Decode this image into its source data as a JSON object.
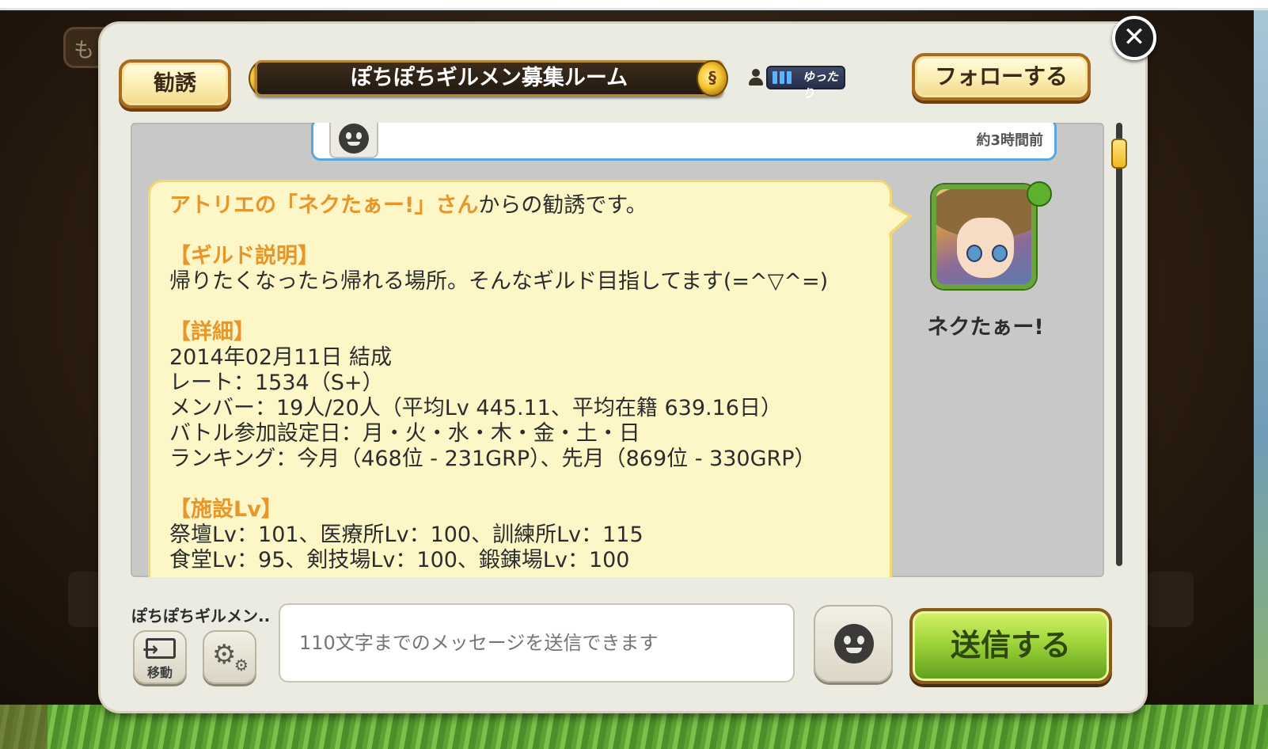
{
  "background": {
    "tab_label": "も"
  },
  "header": {
    "invite_button": "勧誘",
    "room_title": "ぽちぽちギルメン募集ルーム",
    "activity_badge": "ゆったり",
    "follow_button": "フォローする",
    "close_icon": "close-icon"
  },
  "chat": {
    "previous_message": {
      "avatar_icon": "smiley-face-icon",
      "timestamp": "約3時間前"
    },
    "invite_message": {
      "intro_highlight": "アトリエの「ネクたぁー!」さん",
      "intro_rest": "からの勧誘です。",
      "guild_desc_heading": "【ギルド説明】",
      "guild_desc": "帰りたくなったら帰れる場所。そんなギルド目指してます(=^▽^=)",
      "details_heading": "【詳細】",
      "founded": "2014年02月11日 結成",
      "rate": "レート：1534（S+）",
      "members": "メンバー：19人/20人（平均Lv 445.11、平均在籍 639.16日）",
      "battle_days": "バトル参加設定日：月・火・水・木・金・土・日",
      "ranking": "ランキング：今月（468位 - 231GRP）、先月（869位 - 330GRP）",
      "facilities_heading": "【施設Lv】",
      "facilities_1": "祭壇Lv：101、医療所Lv：100、訓練所Lv：115",
      "facilities_2": "食堂Lv：95、剣技場Lv：100、鍛錬場Lv：100"
    },
    "sender_name": "ネクたぁー!"
  },
  "footer": {
    "room_label": "ぽちぽちギルメン..",
    "move_label": "移動",
    "settings_icon": "gear-icon",
    "message_placeholder": "110文字までのメッセージを送信できます",
    "stamp_icon": "smiley-face-icon",
    "send_button": "送信する"
  },
  "colors": {
    "accent_orange": "#e8952a",
    "bubble_bg": "#fdf7c8",
    "send_green": "#9fd43a",
    "scroll_thumb": "#f0b820"
  }
}
